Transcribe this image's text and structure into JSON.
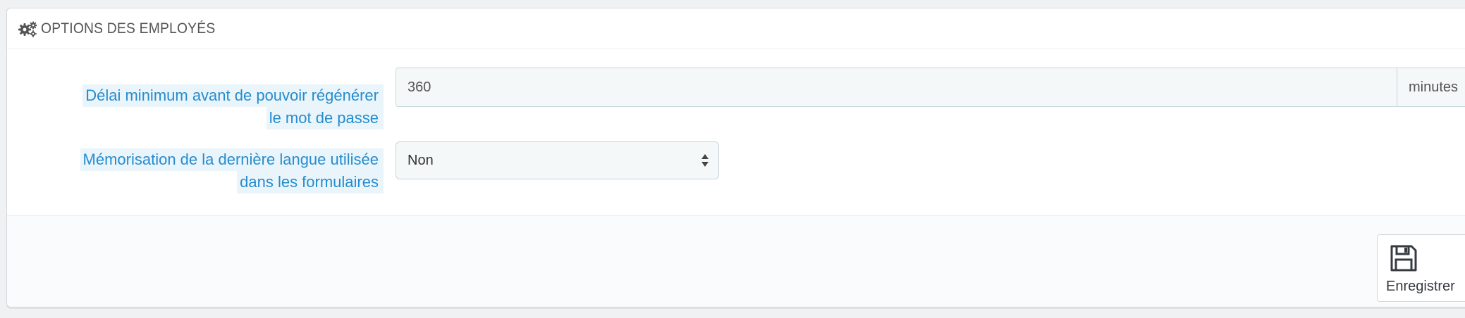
{
  "panel": {
    "title": "OPTIONS DES EMPLOYÉS",
    "icon": "cogs-icon"
  },
  "fields": {
    "password_delay": {
      "label_line1": "Délai minimum avant de pouvoir régénérer",
      "label_line2": "le mot de passe",
      "value": "360",
      "addon": "minutes"
    },
    "remember_language": {
      "label_line1": "Mémorisation de la dernière langue utilisée",
      "label_line2": "dans les formulaires",
      "selected": "Non"
    }
  },
  "footer": {
    "save_label": "Enregistrer",
    "save_icon": "floppy-disk-icon"
  },
  "colors": {
    "label_text": "#268ccd",
    "label_bg": "#e9f5fb",
    "input_bg": "#f5f8f9",
    "border": "#c7d6db"
  }
}
